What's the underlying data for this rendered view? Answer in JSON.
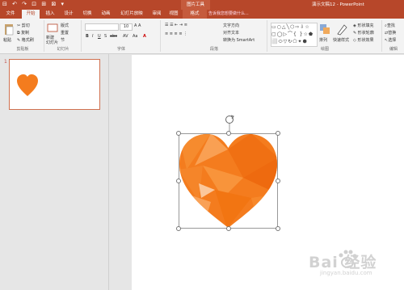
{
  "titlebar": {
    "qat": "⊟ ↶ ↷ ⊡ ⊞ ⊠ ▾",
    "tools_title": "图片工具",
    "doc_title": "演示文稿12 - PowerPoint"
  },
  "tabs": [
    {
      "label": "文件"
    },
    {
      "label": "开始"
    },
    {
      "label": "插入"
    },
    {
      "label": "设计"
    },
    {
      "label": "切换"
    },
    {
      "label": "动画"
    },
    {
      "label": "幻灯片放映"
    },
    {
      "label": "审阅"
    },
    {
      "label": "视图"
    },
    {
      "label": "格式"
    }
  ],
  "tellme": "告诉我您想要做什么...",
  "ribbon": {
    "clipboard": {
      "paste": "粘贴",
      "cut": "剪切",
      "copy": "复制",
      "format_painter": "格式刷",
      "label": "剪贴板"
    },
    "slides": {
      "new_slide": "新建\n幻灯片",
      "layout": "版式",
      "reset": "重置",
      "section": "节",
      "label": "幻灯片"
    },
    "font": {
      "label": "字体",
      "size": "10"
    },
    "paragraph": {
      "text_direction": "文字方向",
      "align_text": "对齐文本",
      "smartart": "转换为 SmartArt",
      "label": "段落"
    },
    "drawing": {
      "arrange": "排列",
      "quick_styles": "快速样式",
      "shape_fill": "形状填充",
      "shape_outline": "形状轮廓",
      "shape_effects": "形状效果",
      "label": "绘图"
    },
    "editing": {
      "find": "查找",
      "replace": "替换",
      "select": "选择",
      "label": "编辑"
    }
  },
  "thumbnail": {
    "number": "1"
  },
  "watermark": {
    "brand": "Bai 经验",
    "url": "jingyan.baidu.com"
  },
  "colors": {
    "accent": "#b7472a",
    "heart": "#f47c1e"
  }
}
